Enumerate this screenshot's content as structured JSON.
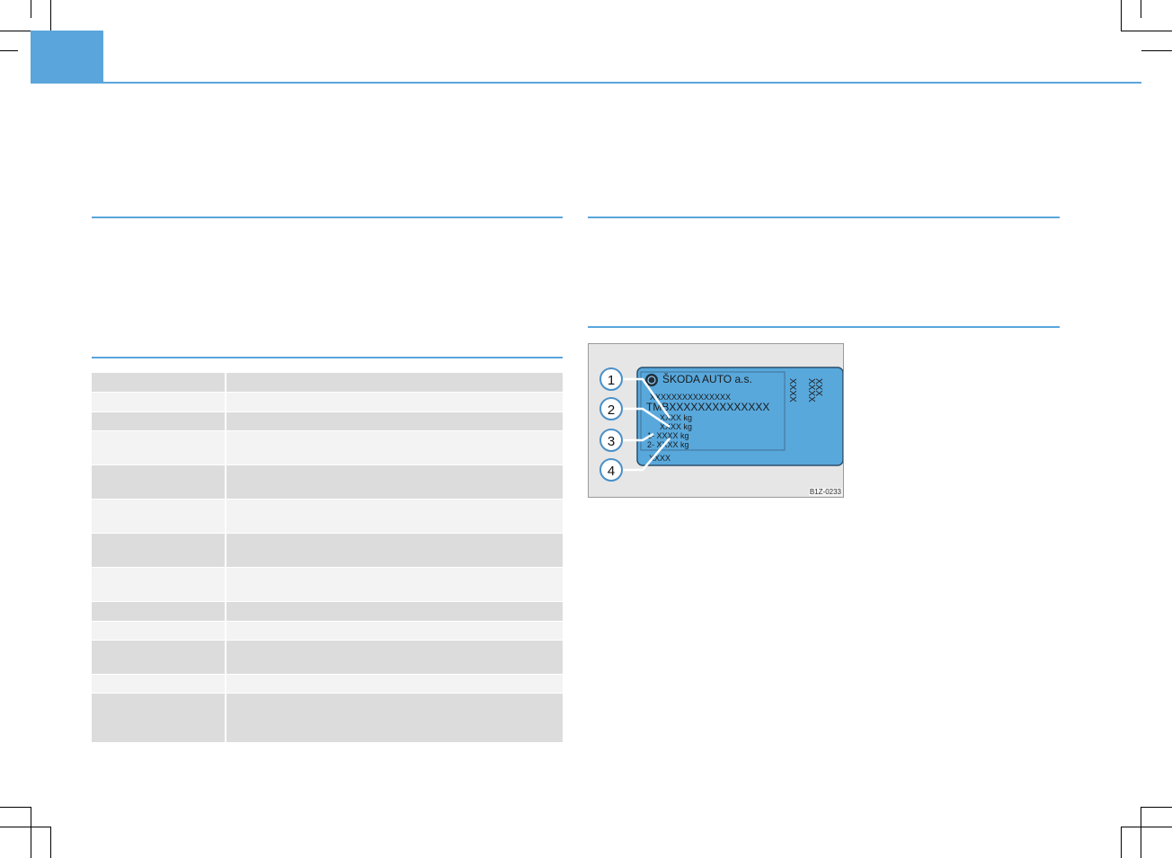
{
  "figure": {
    "label_brand": "ŠKODA  AUTO  a.s.",
    "vin_short": "XXXXXXXXXXXXXXX",
    "vin_long": "TMBXXXXXXXXXXXXXX",
    "weight_1": "XXXX kg",
    "weight_2": "XXXX kg",
    "axle_1": "1-  XXXX kg",
    "axle_2": "2-  XXXX kg",
    "bottom_code": "XXXX",
    "right_col_1": "XXXX",
    "right_col_2": "XXXX",
    "right_col_3": "XXX",
    "callouts": [
      "1",
      "2",
      "3",
      "4"
    ],
    "image_code": "B1Z-0233",
    "colors": {
      "plate": "#58a8dc",
      "accent": "#5aa5dc"
    }
  }
}
